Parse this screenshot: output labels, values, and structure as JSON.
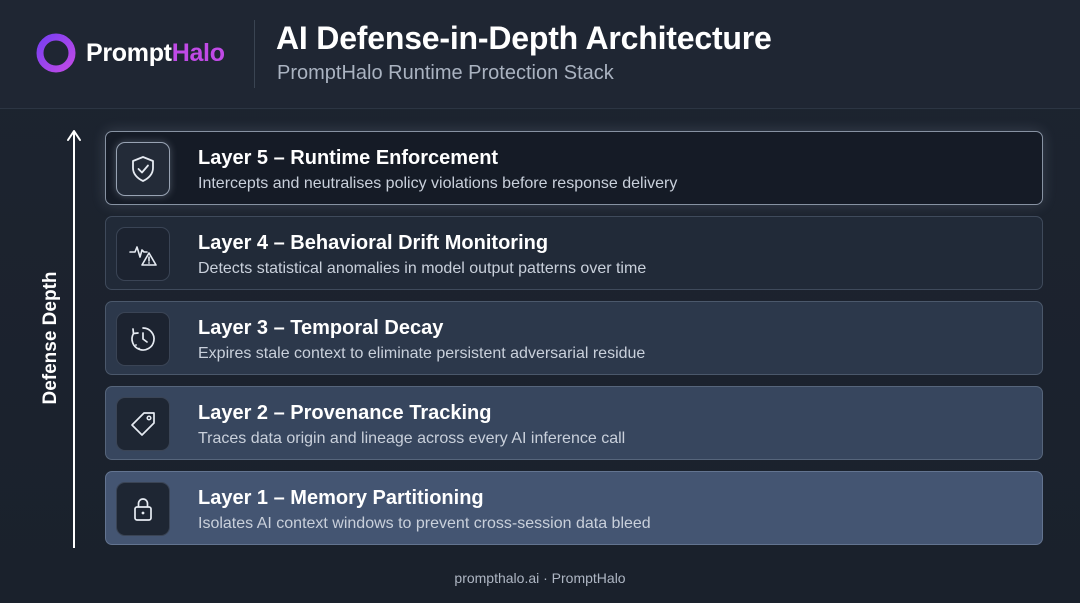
{
  "header": {
    "logo": {
      "text_a": "Prompt",
      "text_b": "Halo",
      "icon": "halo-ring-icon",
      "colors": [
        "#7a3ff2",
        "#c04ae6"
      ]
    },
    "title": "AI Defense-in-Depth Architecture",
    "subtitle": "PromptHalo Runtime Protection Stack"
  },
  "axis": {
    "label": "Defense Depth",
    "icon": "up-arrow-icon"
  },
  "layers": [
    {
      "title": "Layer 5 – Runtime Enforcement",
      "description": "Intercepts and neutralises policy violations before response delivery",
      "icon": "shield-check-icon"
    },
    {
      "title": "Layer 4 – Behavioral Drift Monitoring",
      "description": "Detects statistical anomalies in model output patterns over time",
      "icon": "pulse-warning-icon"
    },
    {
      "title": "Layer 3 – Temporal Decay",
      "description": "Expires stale context to eliminate persistent adversarial residue",
      "icon": "clock-decay-icon"
    },
    {
      "title": "Layer 2 – Provenance Tracking",
      "description": "Traces data origin and lineage across every AI inference call",
      "icon": "tag-icon"
    },
    {
      "title": "Layer 1 – Memory Partitioning",
      "description": "Isolates AI context windows to prevent cross-session data bleed",
      "icon": "padlock-icon"
    }
  ],
  "footer": {
    "text": "prompthalo.ai · PromptHalo"
  }
}
